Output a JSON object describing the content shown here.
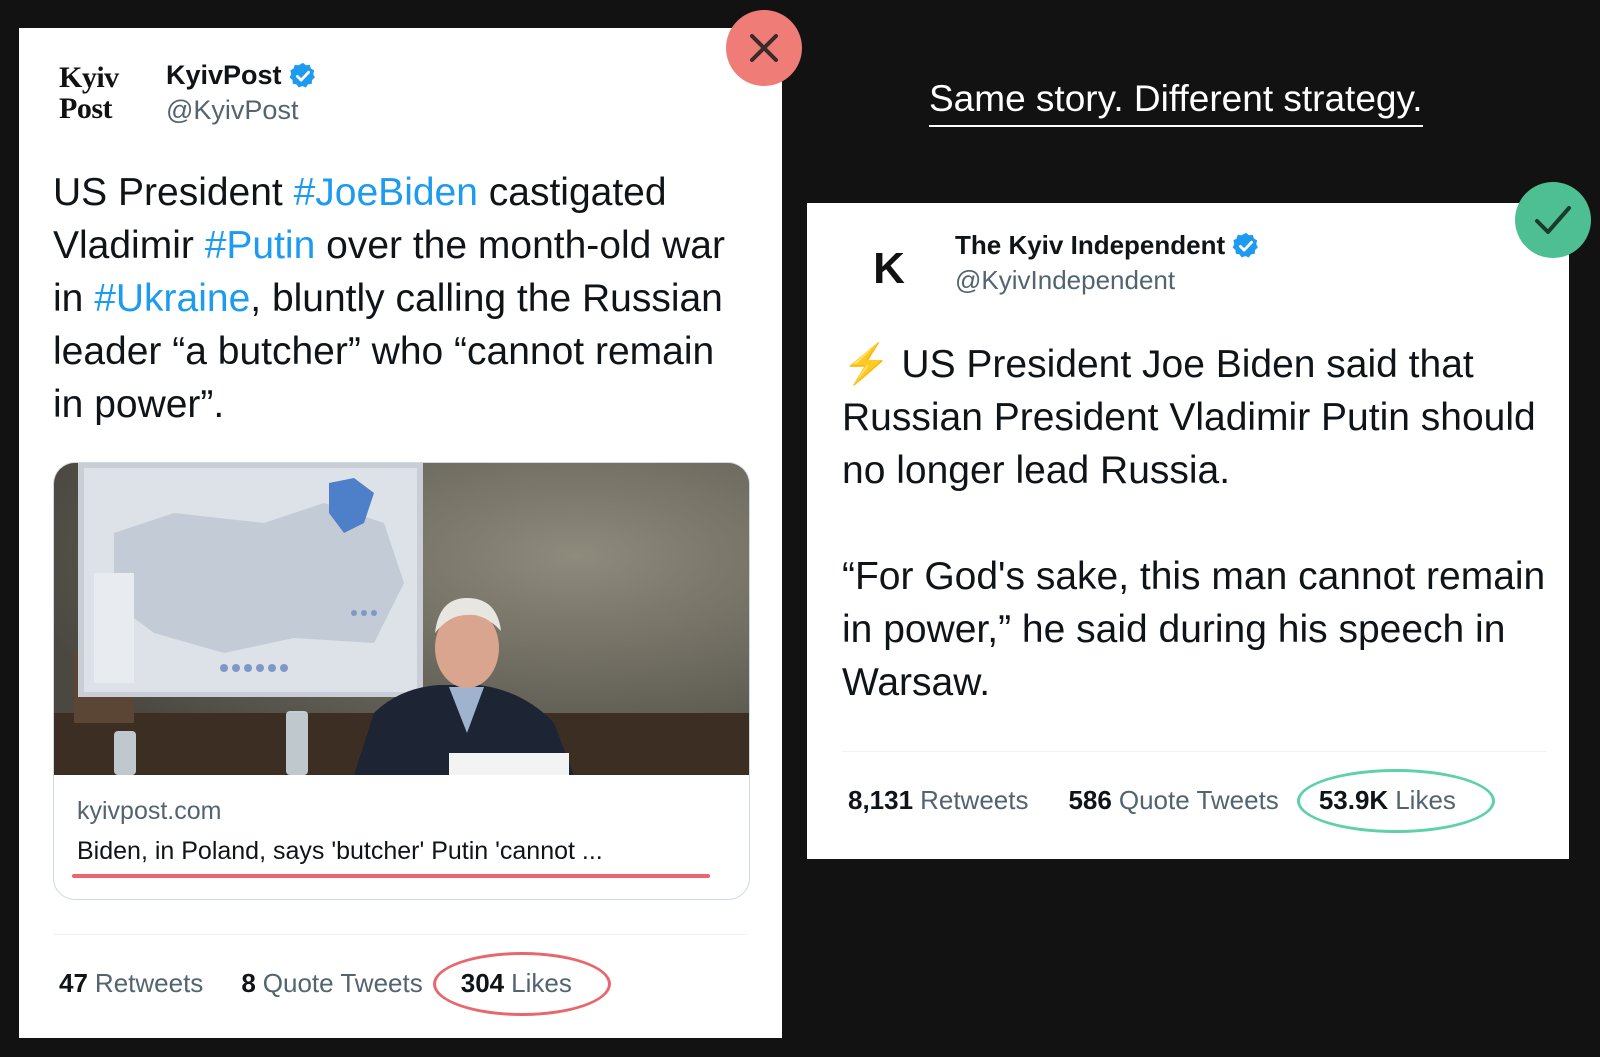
{
  "headline": "Same story. Different strategy.",
  "colors": {
    "background": "#121212",
    "hashtag": "#1d9bf0",
    "bad_marker": "#f07c78",
    "good_marker": "#4dbf93",
    "verified": "#1d9bf0"
  },
  "left_tweet": {
    "avatar_lines": [
      "Kyiv",
      "Post"
    ],
    "name": "KyivPost",
    "handle": "@KyivPost",
    "text": {
      "t1": "US President ",
      "h1": "#JoeBiden",
      "t2": " castigated Vladimir ",
      "h2": "#Putin",
      "t3": " over the month-old war in ",
      "h3": "#Ukraine",
      "t4": ", bluntly calling the Russian leader “a butcher” who “cannot remain in power”."
    },
    "link_card": {
      "domain": "kyivpost.com",
      "title": "Biden, in Poland, says 'butcher' Putin 'cannot ..."
    },
    "stats": {
      "retweets_count": "47",
      "retweets_label": "Retweets",
      "quotes_count": "8",
      "quotes_label": "Quote Tweets",
      "likes_count": "304",
      "likes_label": "Likes"
    },
    "marker_icon": "close-icon"
  },
  "right_tweet": {
    "avatar_letter": "K",
    "name": "The Kyiv Independent",
    "handle": "@KyivIndependent",
    "emoji": "⚡",
    "paragraph1": " US President Joe Biden said that Russian President Vladimir Putin should no longer lead Russia.",
    "paragraph2": "“For God's sake, this man cannot remain in power,” he said during his speech in Warsaw.",
    "stats": {
      "retweets_count": "8,131",
      "retweets_label": "Retweets",
      "quotes_count": "586",
      "quotes_label": "Quote Tweets",
      "likes_count": "53.9K",
      "likes_label": "Likes"
    },
    "marker_icon": "check-icon"
  }
}
